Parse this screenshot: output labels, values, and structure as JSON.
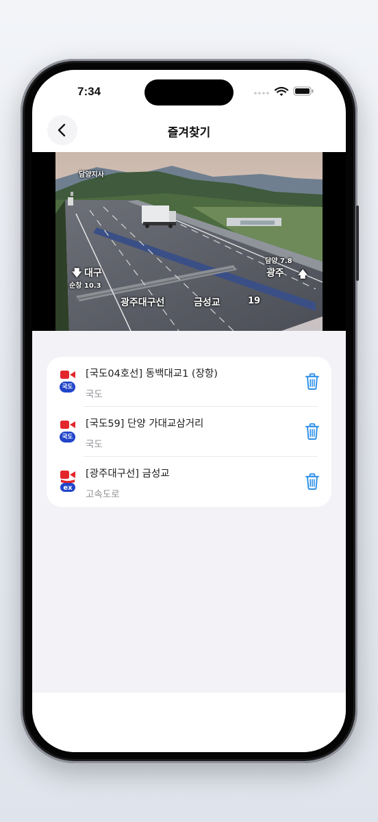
{
  "status_bar": {
    "time": "7:34"
  },
  "nav": {
    "title": "즐겨찾기",
    "back_icon": "chevron-left-icon"
  },
  "cctv": {
    "top_left_label": "담양지사",
    "left_direction": "대구",
    "left_distance": "순창 10.3",
    "right_distance": "담양 7.8",
    "right_direction": "광주",
    "road_name": "광주대구선",
    "location_name": "금성교",
    "camera_number": "19"
  },
  "favorites": [
    {
      "title": "[국도04호선] 동백대교1 (장항)",
      "subtitle": "국도",
      "badge": "국도",
      "badge_type": "national-road"
    },
    {
      "title": "[국도59] 단양 가대교삼거리",
      "subtitle": "국도",
      "badge": "국도",
      "badge_type": "national-road"
    },
    {
      "title": "[광주대구선] 금성교",
      "subtitle": "고속도로",
      "badge": "ex",
      "badge_type": "expressway"
    }
  ],
  "colors": {
    "camera_icon": "#e3262b",
    "national_badge": "#2145c9",
    "trash_icon": "#2a8ee8",
    "list_background": "#f2f2f7"
  }
}
